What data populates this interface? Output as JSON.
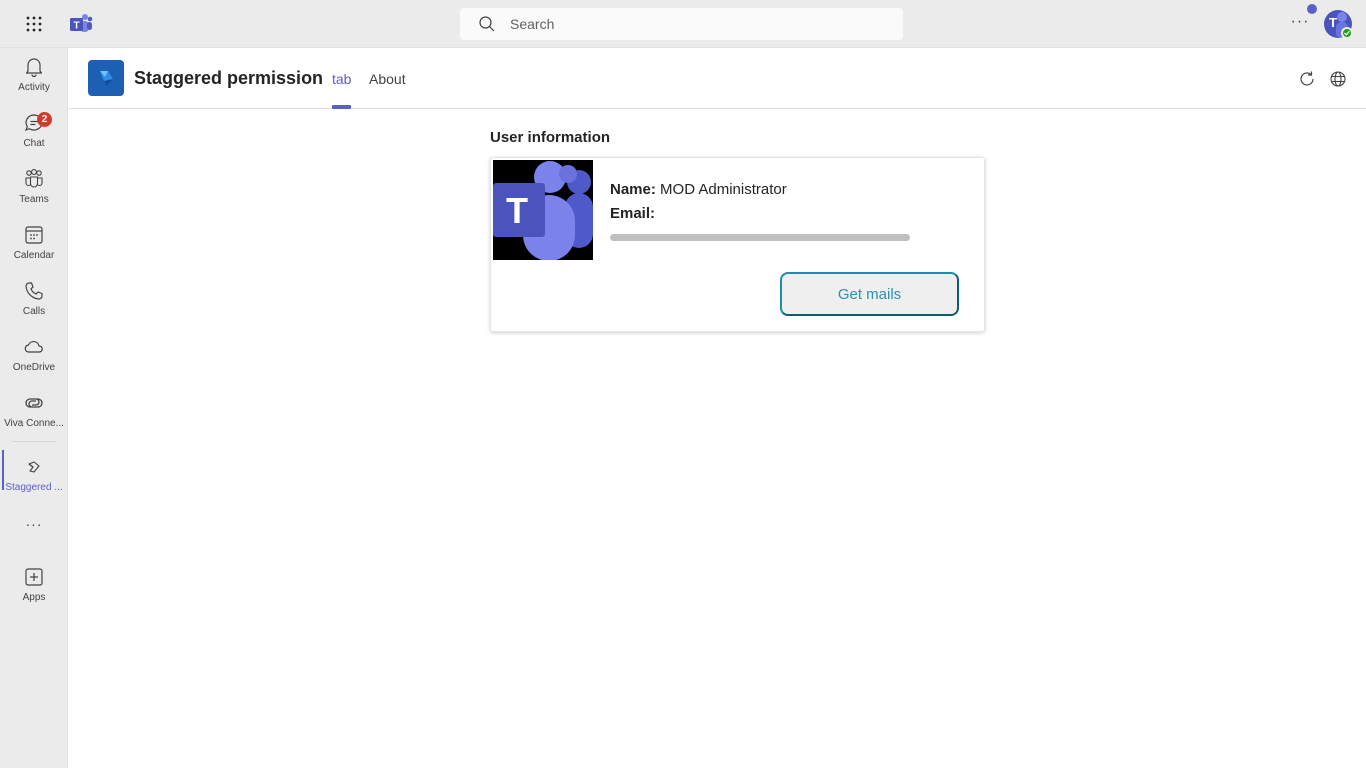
{
  "topbar": {
    "search_placeholder": "Search",
    "more_label": "···",
    "avatar_initial": "T"
  },
  "rail": {
    "items": [
      {
        "label": "Activity",
        "icon": "bell-icon"
      },
      {
        "label": "Chat",
        "icon": "chat-icon",
        "badge": "2"
      },
      {
        "label": "Teams",
        "icon": "teams-icon"
      },
      {
        "label": "Calendar",
        "icon": "calendar-icon"
      },
      {
        "label": "Calls",
        "icon": "phone-icon"
      },
      {
        "label": "OneDrive",
        "icon": "cloud-icon"
      },
      {
        "label": "Viva Conne...",
        "icon": "viva-connections-icon"
      },
      {
        "label": "Staggered ...",
        "icon": "staggered-app-icon",
        "active": true
      },
      {
        "label": "Apps",
        "icon": "add-app-icon"
      }
    ],
    "more_label": "···"
  },
  "app": {
    "title": "Staggered permission",
    "tabs": [
      {
        "label": "tab",
        "active": true
      },
      {
        "label": "About",
        "active": false
      }
    ]
  },
  "content": {
    "section_title": "User information",
    "name_label": "Name:",
    "name_value": "MOD Administrator",
    "email_label": "Email:",
    "email_value_redacted": true,
    "button_label": "Get mails"
  },
  "colors": {
    "accent": "#5b5fc7",
    "badge": "#d13b2a",
    "presence": "#13a10e",
    "button_border": "#1a8fa5",
    "button_text": "#2b8fb0"
  }
}
